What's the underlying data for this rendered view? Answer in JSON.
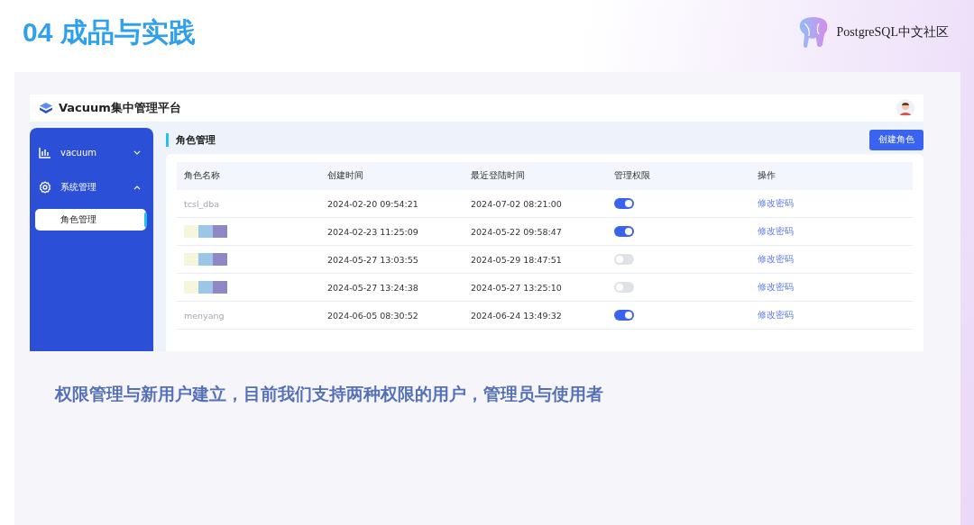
{
  "slide_title": "04 成品与实践",
  "brand": "PostgreSQL中文社区",
  "app": {
    "title": "Vacuum集中管理平台",
    "sidebar": {
      "items": [
        {
          "label": "vacuum",
          "kind": "chart",
          "expanded": false
        },
        {
          "label": "系统管理",
          "kind": "gear",
          "expanded": true,
          "children": [
            {
              "label": "角色管理",
              "selected": true
            }
          ]
        }
      ]
    },
    "page_title": "角色管理",
    "create_button": "创建角色",
    "table": {
      "columns": [
        "角色名称",
        "创建时间",
        "最近登陆时间",
        "管理权限",
        "操作"
      ],
      "rows": [
        {
          "name": "tcsl_dba",
          "redacted": false,
          "created": "2024-02-20 09:54:21",
          "last_login": "2024-07-02 08:21:00",
          "admin": true,
          "action": "修改密码"
        },
        {
          "redacted": true,
          "created": "2024-02-23 11:25:09",
          "last_login": "2024-05-22 09:58:47",
          "admin": true,
          "action": "修改密码"
        },
        {
          "redacted": true,
          "created": "2024-05-27 13:03:55",
          "last_login": "2024-05-29 18:47:51",
          "admin": false,
          "action": "修改密码"
        },
        {
          "redacted": true,
          "created": "2024-05-27 13:24:38",
          "last_login": "2024-05-27 13:25:10",
          "admin": false,
          "action": "修改密码"
        },
        {
          "name": "menyang",
          "redacted": false,
          "created": "2024-06-05 08:30:52",
          "last_login": "2024-06-24 13:49:32",
          "admin": true,
          "action": "修改密码"
        }
      ]
    }
  },
  "caption": "权限管理与新用户建立，目前我们支持两种权限的用户，管理员与使用者"
}
